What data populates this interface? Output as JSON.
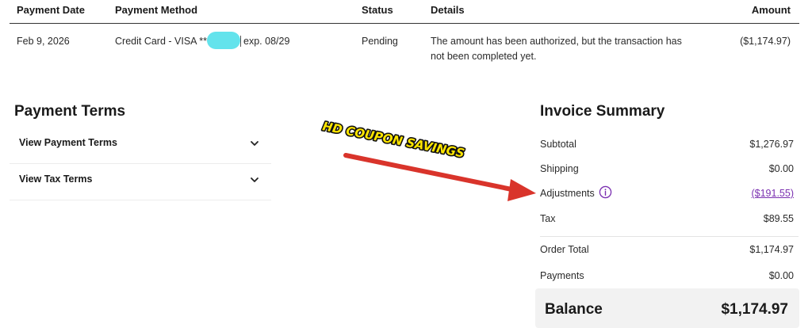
{
  "payments": {
    "headers": {
      "date": "Payment Date",
      "method": "Payment Method",
      "status": "Status",
      "details": "Details",
      "amount": "Amount"
    },
    "rows": [
      {
        "date": "Feb 9, 2026",
        "method_prefix": "Credit Card - VISA **",
        "method_suffix": "exp. 08/29",
        "status": "Pending",
        "details_line1": "The amount has been authorized, but the transaction has",
        "details_line2": "not been completed yet.",
        "amount": "($1,174.97)"
      }
    ]
  },
  "payment_terms": {
    "title": "Payment Terms",
    "items": [
      {
        "label": "View Payment Terms"
      },
      {
        "label": "View Tax Terms"
      }
    ]
  },
  "invoice_summary": {
    "title": "Invoice Summary",
    "subtotal": {
      "label": "Subtotal",
      "value": "$1,276.97"
    },
    "shipping": {
      "label": "Shipping",
      "value": "$0.00"
    },
    "adjustments": {
      "label": "Adjustments",
      "value": "($191.55)"
    },
    "tax": {
      "label": "Tax",
      "value": "$89.55"
    },
    "order_total": {
      "label": "Order Total",
      "value": "$1,174.97"
    },
    "payments": {
      "label": "Payments",
      "value": "$0.00"
    },
    "balance": {
      "label": "Balance",
      "value": "$1,174.97"
    }
  },
  "annotation": {
    "text": "HD COUPON SAVINGS",
    "text_color": "#ffe600",
    "outline_color": "#111111",
    "arrow_color": "#d9342b"
  },
  "colors": {
    "link": "#7a2fb0",
    "redaction": "#63e3ec",
    "balance_bg": "#f2f2f2"
  }
}
